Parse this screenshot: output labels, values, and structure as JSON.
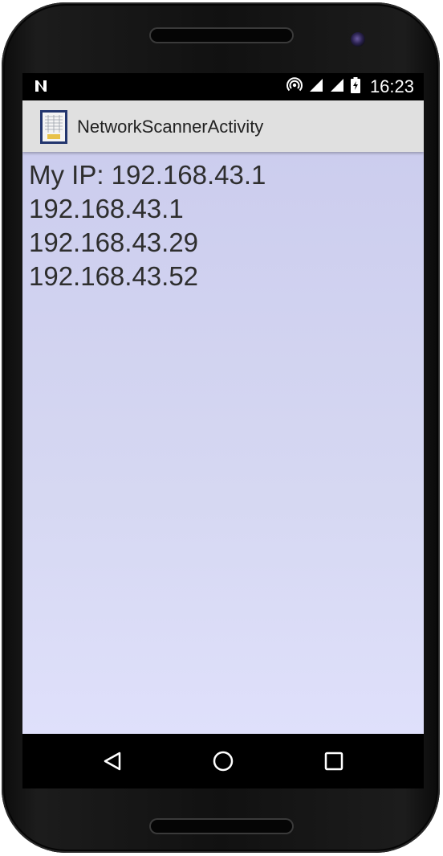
{
  "status_bar": {
    "time": "16:23",
    "icons": [
      "n-notification-icon",
      "hotspot-icon",
      "signal-icon",
      "signal-icon",
      "battery-charging-icon"
    ]
  },
  "app_bar": {
    "title": "NetworkScannerActivity",
    "icon": "app-launcher-icon"
  },
  "content": {
    "lines": [
      "My IP: 192.168.43.1",
      "192.168.43.1",
      "192.168.43.29",
      "192.168.43.52"
    ]
  },
  "nav_bar": {
    "buttons": [
      "back-icon",
      "home-icon",
      "recents-icon"
    ]
  },
  "colors": {
    "content_bg_top": "#cccdee",
    "content_bg_bottom": "#dfe0fb",
    "app_bar_bg": "#e0e0e0",
    "text": "#2e2e2e"
  }
}
